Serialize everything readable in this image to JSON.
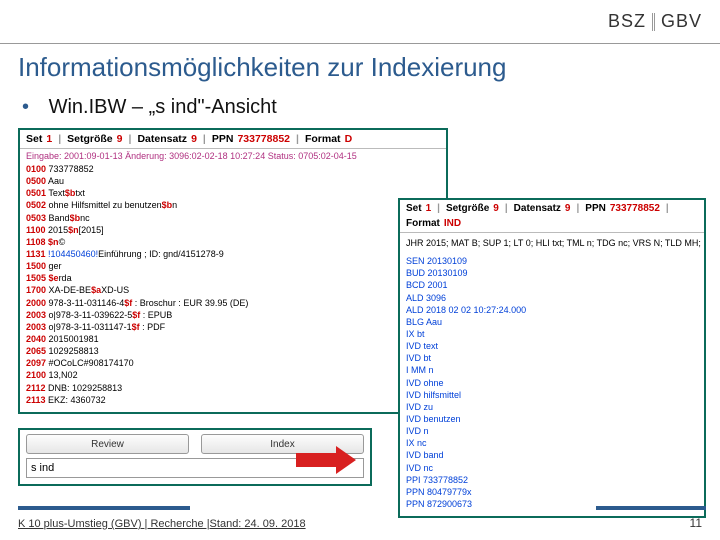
{
  "header": {
    "brand_left": "BSZ",
    "brand_right": "GBV"
  },
  "title": "Informationsmöglichkeiten zur Indexierung",
  "bullet": "Win.IBW – „s ind\"-Ansicht",
  "left_panel": {
    "head": {
      "set_lbl": "Set",
      "set": "1",
      "sg_lbl": "Setgröße",
      "sg": "9",
      "ds_lbl": "Datensatz",
      "ds": "9",
      "ppn_lbl": "PPN",
      "ppn": "733778852",
      "fmt_lbl": "Format",
      "fmt": "D"
    },
    "eingabe": "Eingabe: 2001:09-01-13 Änderung: 3096:02-02-18 10:27:24 Status: 0705:02-04-15",
    "rows": [
      {
        "code": "0100",
        "rest": "733778852"
      },
      {
        "code": "0500",
        "rest": "Aau"
      },
      {
        "code": "0501",
        "rest": "Text$btxt"
      },
      {
        "code": "0502",
        "rest": "ohne Hilfsmittel zu benutzen$bn"
      },
      {
        "code": "0503",
        "rest": "Band$bnc"
      },
      {
        "code": "1100",
        "rest": "2015$n[2015]"
      },
      {
        "code": "1108",
        "rest": "$n©"
      },
      {
        "code": "1131",
        "rest": "!104450460!Einführung ; ID: gnd/4151278-9"
      },
      {
        "code": "1500",
        "rest": "ger"
      },
      {
        "code": "1505",
        "rest": "$erda"
      },
      {
        "code": "1700",
        "rest": "XA-DE-BE$aXD-US"
      },
      {
        "code": "2000",
        "rest": "978-3-11-031146-4$f : Broschur : EUR 39.95 (DE)"
      },
      {
        "code": "2003",
        "rest": "o|978-3-11-039622-5$f : EPUB"
      },
      {
        "code": "2003",
        "rest": "o|978-3-11-031147-1$f : PDF"
      },
      {
        "code": "2040",
        "rest": "2015001981"
      },
      {
        "code": "2065",
        "rest": "1029258813"
      },
      {
        "code": "2097",
        "rest": "#OCoLC#908174170"
      },
      {
        "code": "2100",
        "rest": "13,N02"
      },
      {
        "code": "2112",
        "rest": "DNB: 1029258813"
      },
      {
        "code": "2113",
        "rest": "EKZ: 4360732"
      }
    ]
  },
  "right_panel": {
    "head": {
      "set_lbl": "Set",
      "set": "1",
      "sg_lbl": "Setgröße",
      "sg": "9",
      "ds_lbl": "Datensatz",
      "ds": "9",
      "ppn_lbl": "PPN",
      "ppn": "733778852",
      "fmt_lbl": "Format",
      "fmt": "IND"
    },
    "line1": "JHR 2015; MAT B; SUP 1; LT 0; HLI txt; TML n; TDG nc; VRS N; TLD MH;",
    "rows": [
      "SEN 20130109",
      "BUD 20130109",
      "BCD 2001",
      "ALD 3096",
      "ALD 2018 02 02 10:27:24.000",
      "BLG Aau",
      "  IX bt",
      "IVD text",
      "IVD bt",
      "  I MM n",
      "IVD ohne",
      "IVD hilfsmittel",
      "IVD zu",
      "IVD benutzen",
      "IVD n",
      "  IX nc",
      "IVD band",
      "IVD nc",
      "PPI 733778852",
      "PPN 80479779x",
      "PPN 872900673"
    ]
  },
  "btnbar": {
    "review": "Review",
    "index": "Index",
    "command": "s ind"
  },
  "footer": {
    "text": "K 10 plus-Umstieg (GBV) | Recherche |Stand: 24. 09. 2018",
    "page": "11"
  }
}
